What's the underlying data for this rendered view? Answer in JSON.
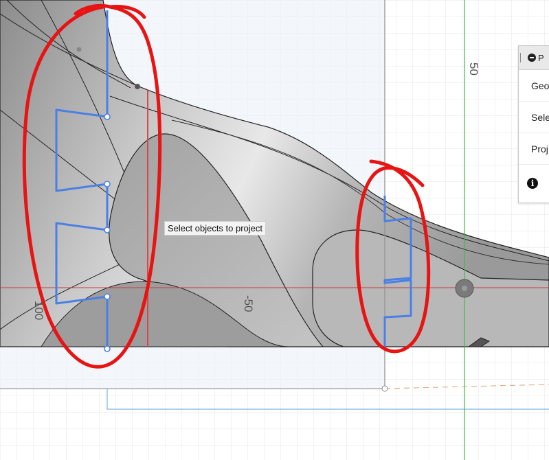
{
  "viewport": {
    "tooltip": "Select objects to project",
    "dimension_labels": [
      "50",
      "-50",
      "100"
    ]
  },
  "projection_panel": {
    "title": "P",
    "rows": [
      "Geo",
      "Sele",
      "Proj"
    ],
    "info_icon": "i"
  },
  "colors": {
    "grid": "#e6e6e6",
    "grid_major": "#d6d6d6",
    "sketch_blue": "#4a7fe6",
    "markup_red": "#e81313",
    "axis_red": "#c93a3a",
    "axis_green": "#3bbf3b",
    "body_grey": "#a9a9a9"
  }
}
